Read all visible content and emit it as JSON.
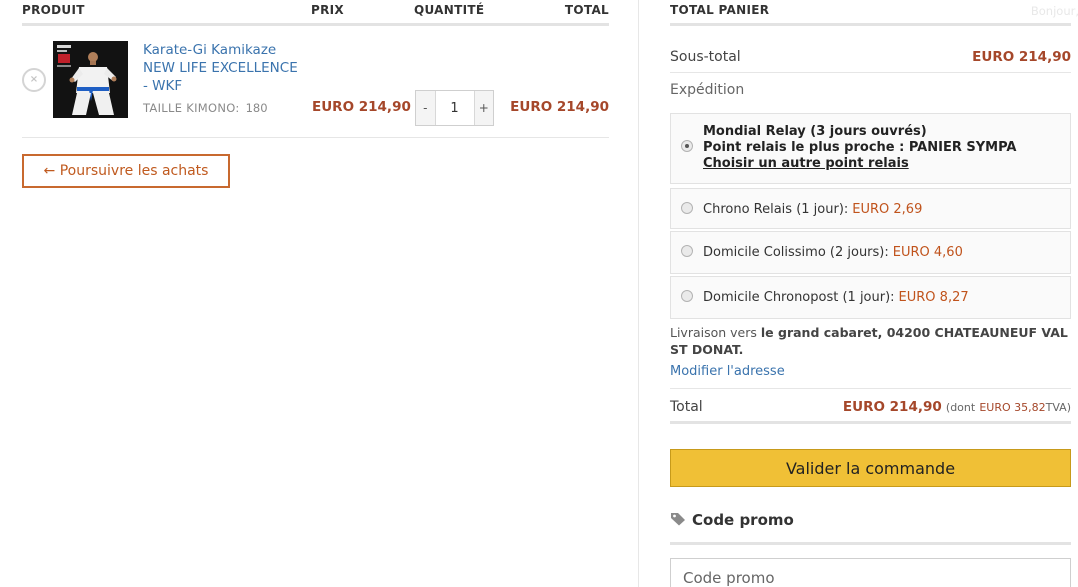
{
  "cart": {
    "headers": {
      "product": "PRODUIT",
      "price": "PRIX",
      "quantity": "QUANTITÉ",
      "total": "TOTAL"
    },
    "item": {
      "name": "Karate-Gi Kamikaze NEW LIFE EXCELLENCE - WKF",
      "meta_label": "TAILLE KIMONO:",
      "meta_value": "180",
      "price": "EURO 214,90",
      "quantity": "1",
      "minus": "-",
      "plus": "+",
      "remove": "×",
      "line_total": "EURO 214,90"
    },
    "continue_label": "← Poursuivre les achats"
  },
  "totals": {
    "title": "TOTAL PANIER",
    "greeting": "Bonjour,",
    "subtotal_label": "Sous-total",
    "subtotal_value": "EURO 214,90",
    "shipping_label": "Expédition",
    "shipping_options": [
      {
        "name": "Mondial Relay (3 jours ouvrés)",
        "detail": "Point relais le plus proche : PANIER SYMPA",
        "link": "Choisir un autre point relais",
        "selected": true
      },
      {
        "name": "Chrono Relais (1 jour):",
        "price": "EURO 2,69",
        "selected": false
      },
      {
        "name": "Domicile Colissimo (2 jours):",
        "price": "EURO 4,60",
        "selected": false
      },
      {
        "name": "Domicile Chronopost (1 jour):",
        "price": "EURO 8,27",
        "selected": false
      }
    ],
    "delivery_prefix": "Livraison vers",
    "delivery_address": "le grand cabaret, 04200 CHATEAUNEUF VAL ST DONAT.",
    "edit_address": "Modifier l'adresse",
    "total_label": "Total",
    "total_value": "EURO 214,90",
    "tax_prefix": "(dont",
    "tax_value": "EURO 35,82",
    "tax_suffix": "TVA)",
    "checkout_label": "Valider la commande",
    "promo_title": "Code promo",
    "promo_placeholder": "Code promo"
  },
  "colors": {
    "accent": "#c05a1f",
    "price": "#a5472a",
    "checkout": "#f0c036",
    "link": "#3a73ad"
  }
}
